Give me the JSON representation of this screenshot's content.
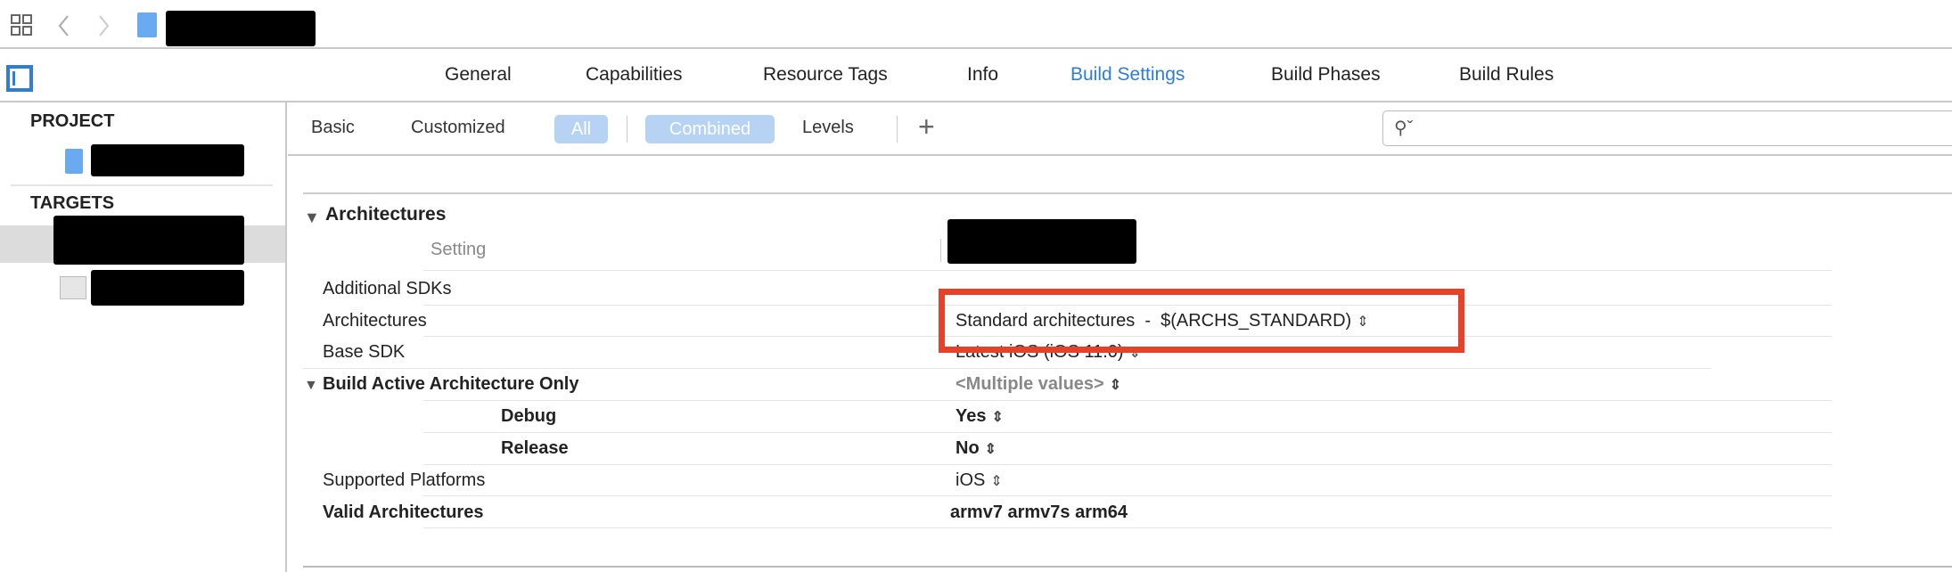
{
  "toolbar": {
    "icons": [
      "grid-icon",
      "back-chevron-icon",
      "forward-chevron-icon",
      "app-file-icon"
    ]
  },
  "tabs": [
    {
      "label": "General"
    },
    {
      "label": "Capabilities"
    },
    {
      "label": "Resource Tags"
    },
    {
      "label": "Info"
    },
    {
      "label": "Build Settings",
      "active": true
    },
    {
      "label": "Build Phases"
    },
    {
      "label": "Build Rules"
    }
  ],
  "sidebar": {
    "project_header": "PROJECT",
    "targets_header": "TARGETS"
  },
  "filter": {
    "basic": "Basic",
    "customized": "Customized",
    "all": "All",
    "combined": "Combined",
    "levels": "Levels",
    "add": "+",
    "search_placeholder": ""
  },
  "section": {
    "title": "Architectures",
    "setting_col": "Setting"
  },
  "rows": [
    {
      "label": "Additional SDKs",
      "value": ""
    },
    {
      "label": "Architectures",
      "value": "Standard architectures  -  $(ARCHS_STANDARD)"
    },
    {
      "label": "Base SDK",
      "value": "Latest iOS (iOS 11.0)"
    },
    {
      "label": "Build Active Architecture Only",
      "value": "<Multiple values>"
    },
    {
      "label": "Debug",
      "value": "Yes"
    },
    {
      "label": "Release",
      "value": "No"
    },
    {
      "label": "Supported Platforms",
      "value": "iOS"
    },
    {
      "label": "Valid Architectures",
      "value": "armv7 armv7s arm64"
    }
  ],
  "colors": {
    "accent": "#2f7ddb",
    "highlight": "#e8412a",
    "pill": "#b7d3f4"
  }
}
